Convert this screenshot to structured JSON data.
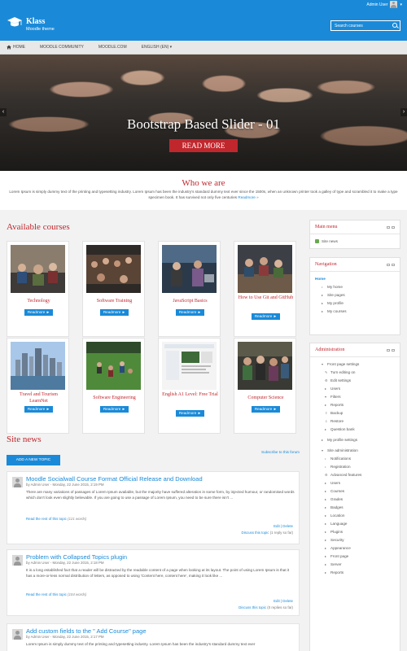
{
  "user": {
    "name": "Admin User",
    "caret": "▾"
  },
  "brand": {
    "title": "Klass",
    "subtitle": "Moodle theme"
  },
  "search": {
    "placeholder": "Search courses"
  },
  "nav": {
    "home": "HOME",
    "items": [
      "MOODLE COMMUNITY",
      "MOODLE.COM",
      "ENGLISH (EN) ▾"
    ]
  },
  "slider": {
    "caption": "Bootstrap Based Slider - 01",
    "button": "READ MORE",
    "prev": "‹",
    "next": "›"
  },
  "who": {
    "title": "Who we are",
    "text": "Lorem Ipsum is simply dummy text of the printing and typesetting industry. Lorem Ipsum has been the industry's standard dummy text ever since the 1500s, when an unknown printer took a galley of type and scrambled it to make a type specimen book. It has survived not only five centuries",
    "link": "Readmore »"
  },
  "courses": {
    "title": "Available courses",
    "button": "Readmore ►",
    "items": [
      {
        "name": "Technology",
        "img": "classroom"
      },
      {
        "name": "Software Training",
        "img": "lecture"
      },
      {
        "name": "JavaScript Basics",
        "img": "people"
      },
      {
        "name": "How to Use Git and GitHub",
        "img": "meeting"
      },
      {
        "name": "Travel and Tourism LearnNet",
        "img": "city"
      },
      {
        "name": "Software Engineering",
        "img": "field"
      },
      {
        "name": "English A1 Level: Free Trial",
        "img": "screen"
      },
      {
        "name": "Computer Science",
        "img": "group"
      }
    ]
  },
  "news": {
    "title": "Site news",
    "add_button": "ADD A NEW TOPIC",
    "subscribe": "Subscribe to this forum",
    "read_rest": "Read the rest of this topic",
    "edit": "Edit",
    "delete": "Delete",
    "discuss": "Discuss this topic",
    "posts": [
      {
        "title": "Moodle Socialwall Course Format Official Release and Download",
        "meta": "by Admin User - Monday, 22 June 2015, 2:19 PM",
        "body": "There are many variations of passages of Lorem Ipsum available, but the majority have suffered alteration in some form, by injected humour, or randomised words which don't look even slightly believable. If you are going to use a passage of Lorem Ipsum, you need to be sure there isn't ...",
        "words": "(121 words)",
        "replies": "(1 reply so far)"
      },
      {
        "title": "Problem with Collapsed Topics plugin",
        "meta": "by Admin User - Monday, 22 June 2015, 2:18 PM",
        "body": "It is a long established fact that a reader will be distracted by the readable content of a page when looking at its layout. The point of using Lorem Ipsum is that it has a more-or-less normal distribution of letters, as opposed to using 'Content here, content here', making it look like ...",
        "words": "(104 words)",
        "replies": "(0 replies so far)"
      },
      {
        "title": "Add custom fields to the \" Add Course\" page",
        "meta": "by Admin User - Monday, 22 June 2015, 2:17 PM",
        "body": "Lorem Ipsum is simply dummy text of the printing and typesetting industry. Lorem Ipsum has been the industry's standard dummy text ever",
        "words": "",
        "replies": ""
      }
    ]
  },
  "sidebar": {
    "main_menu": {
      "title": "Main menu",
      "items": [
        "Site news"
      ]
    },
    "navigation": {
      "title": "Navigation",
      "home": "Home",
      "items": [
        "My home",
        "Site pages",
        "My profile",
        "My courses"
      ]
    },
    "administration": {
      "title": "Administration",
      "front_page": "Front page settings",
      "front_items": [
        "Turn editing on",
        "Edit settings",
        "Users",
        "Filters",
        "Reports",
        "Backup",
        "Restore",
        "Question bank"
      ],
      "profile": "My profile settings",
      "site_admin": "Site administration",
      "site_items": [
        "Notifications",
        "Registration",
        "Advanced features",
        "Users",
        "Courses",
        "Grades",
        "Badges",
        "Location",
        "Language",
        "Plugins",
        "Security",
        "Appearance",
        "Front page",
        "Server",
        "Reports"
      ]
    }
  }
}
